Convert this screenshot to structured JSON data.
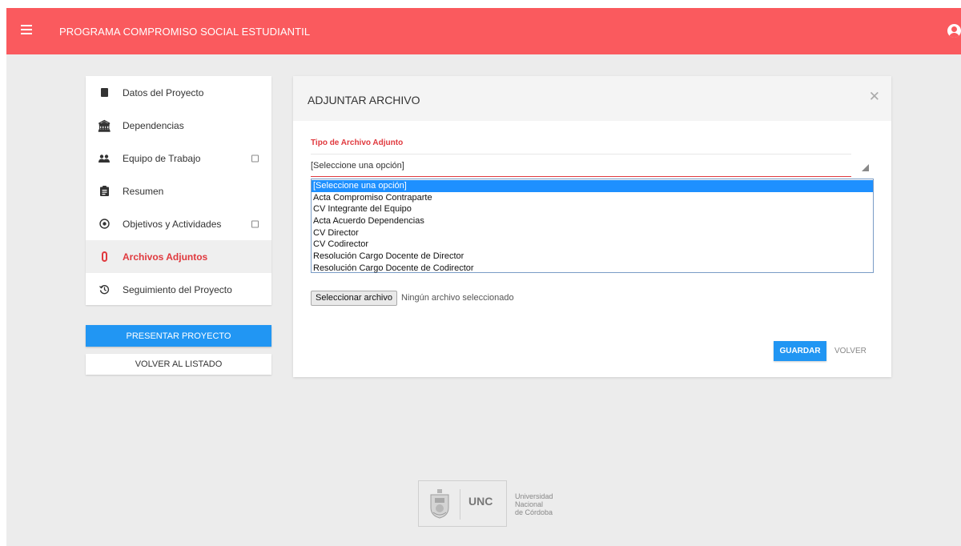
{
  "header": {
    "title": "PROGRAMA COMPROMISO SOCIAL ESTUDIANTIL",
    "menu_icon": "hamburger-menu-icon",
    "user_icon": "account-circle-icon",
    "color": "#fa5a5e"
  },
  "sidebar": {
    "items": [
      {
        "label": "Datos del Proyecto",
        "icon": "book-icon",
        "has_check": false,
        "active": false
      },
      {
        "label": "Dependencias",
        "icon": "institution-icon",
        "has_check": false,
        "active": false
      },
      {
        "label": "Equipo de Trabajo",
        "icon": "people-icon",
        "has_check": true,
        "active": false
      },
      {
        "label": "Resumen",
        "icon": "clipboard-icon",
        "has_check": false,
        "active": false
      },
      {
        "label": "Objetivos y Actividades",
        "icon": "target-icon",
        "has_check": true,
        "active": false
      },
      {
        "label": "Archivos Adjuntos",
        "icon": "paperclip-icon",
        "has_check": false,
        "active": true
      },
      {
        "label": "Seguimiento del Proyecto",
        "icon": "history-icon",
        "has_check": false,
        "active": false
      }
    ],
    "present_label": "PRESENTAR PROYECTO",
    "back_to_list_label": "VOLVER AL LISTADO"
  },
  "panel": {
    "title": "ADJUNTAR ARCHIVO",
    "close_icon": "close-icon",
    "field_label": "Tipo de Archivo Adjunto",
    "selected_value": "[Seleccione una opción]",
    "options": [
      "[Seleccione una opción]",
      "Acta Compromiso Contraparte",
      "CV Integrante del Equipo",
      "Acta Acuerdo Dependencias",
      "CV Director",
      "CV Codirector",
      "Resolución Cargo Docente de Director",
      "Resolución Cargo Docente de Codirector"
    ],
    "file_button_label": "Seleccionar archivo",
    "file_status": "Ningún archivo seleccionado",
    "save_label": "GUARDAR",
    "back_label": "VOLVER"
  },
  "footer": {
    "abbr": "UNC",
    "university_lines": [
      "Universidad",
      "Nacional",
      "de Córdoba"
    ]
  },
  "colors": {
    "accent_red": "#e0393e",
    "primary_blue": "#2196f3",
    "option_highlight": "#1e90ff"
  }
}
